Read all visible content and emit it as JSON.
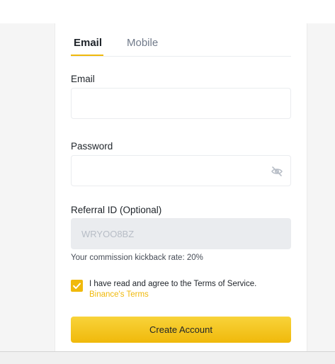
{
  "tabs": [
    {
      "label": "Email",
      "active": true
    },
    {
      "label": "Mobile",
      "active": false
    }
  ],
  "email_field": {
    "label": "Email",
    "value": "",
    "placeholder": ""
  },
  "password_field": {
    "label": "Password",
    "value": "",
    "placeholder": "",
    "toggle_icon": "eye-slash-icon"
  },
  "referral_field": {
    "label": "Referral ID (Optional)",
    "value": "WRYOO8BZ",
    "readonly": true
  },
  "kickback_text": "Your commission kickback rate: 20%",
  "agree": {
    "checked": true,
    "text": "I have read and agree to the Terms of Service.",
    "link_text": "Binance's Terms"
  },
  "create_button_label": "Create Account",
  "colors": {
    "accent": "#f0b90b",
    "text": "#1e2329",
    "muted": "#707a8a",
    "input_border": "#eaecef",
    "readonly_bg": "#eaecef"
  }
}
